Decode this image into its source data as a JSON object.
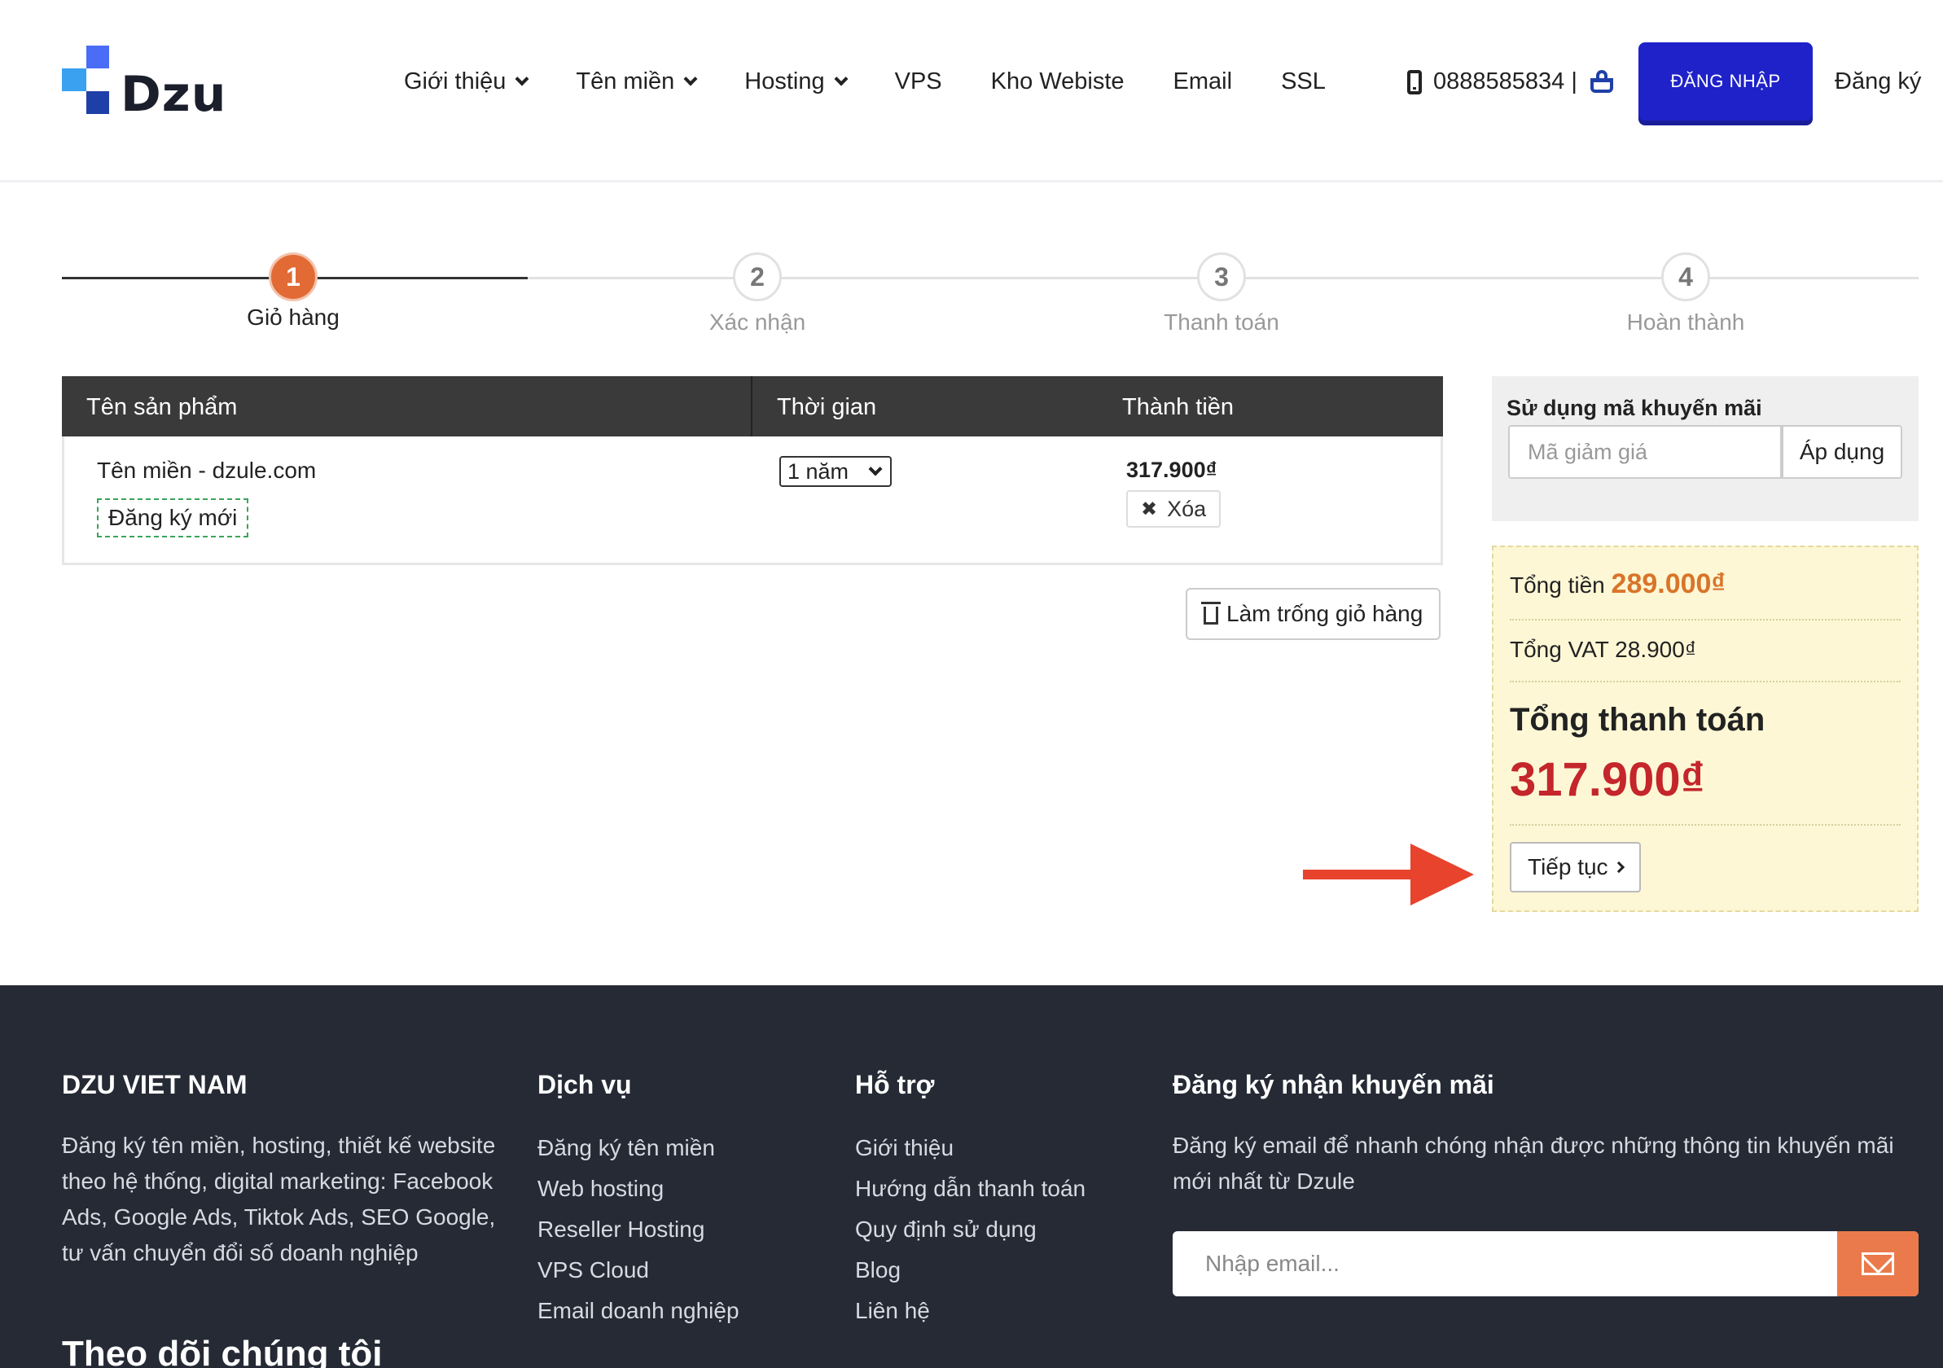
{
  "header": {
    "logo_text": "Dzu",
    "nav": [
      {
        "label": "Giới thiệu",
        "dropdown": true
      },
      {
        "label": "Tên miền",
        "dropdown": true
      },
      {
        "label": "Hosting",
        "dropdown": true
      },
      {
        "label": "VPS",
        "dropdown": false
      },
      {
        "label": "Kho Webiste",
        "dropdown": false
      },
      {
        "label": "Email",
        "dropdown": false
      },
      {
        "label": "SSL",
        "dropdown": false
      }
    ],
    "phone": "0888585834 |",
    "login_label": "ĐĂNG NHẬP",
    "register_label": "Đăng ký"
  },
  "steps": [
    {
      "number": "1",
      "label": "Giỏ hàng",
      "active": true
    },
    {
      "number": "2",
      "label": "Xác nhận",
      "active": false
    },
    {
      "number": "3",
      "label": "Thanh toán",
      "active": false
    },
    {
      "number": "4",
      "label": "Hoàn thành",
      "active": false
    }
  ],
  "cart": {
    "headers": [
      "Tên sản phẩm",
      "Thời gian",
      "Thành tiền"
    ],
    "items": [
      {
        "name": "Tên miền - dzule.com",
        "tag": "Đăng ký mới",
        "period": "1 năm",
        "price": "317.900₫",
        "remove_label": "Xóa"
      }
    ],
    "empty_label": "Làm trống giỏ hàng"
  },
  "promo": {
    "title": "Sử dụng mã khuyến mãi",
    "placeholder": "Mã giảm giá",
    "apply_label": "Áp dụng"
  },
  "summary": {
    "subtotal_label": "Tổng tiền",
    "subtotal_value": "289.000₫",
    "vat_label": "Tổng VAT 28.900₫",
    "total_label": "Tổng thanh toán",
    "total_value": "317.900₫",
    "continue_label": "Tiếp tục"
  },
  "footer": {
    "about_title": "DZU VIET NAM",
    "about_text": "Đăng ký tên miền, hosting, thiết kế website theo hệ thống, digital marketing: Facebook Ads, Google Ads, Tiktok Ads, SEO Google, tư vấn chuyển đổi số doanh nghiệp",
    "follow_title": "Theo dõi chúng tôi",
    "services_title": "Dịch vụ",
    "services": [
      "Đăng ký tên miền",
      "Web hosting",
      "Reseller Hosting",
      "VPS Cloud",
      "Email doanh nghiệp"
    ],
    "support_title": "Hỗ trợ",
    "support": [
      "Giới thiệu",
      "Hướng dẫn thanh toán",
      "Quy định sử dụng",
      "Blog",
      "Liên hệ"
    ],
    "newsletter_title": "Đăng ký nhận khuyến mãi",
    "newsletter_text": "Đăng ký email để nhanh chóng nhận được những thông tin khuyến mãi mới nhất từ Dzule",
    "email_placeholder": "Nhập email..."
  },
  "colors": {
    "login_button": "#1f22c8",
    "active_step": "#e26a35",
    "total_price": "#c4262b",
    "subtotal_price": "#d9742a",
    "footer_bg": "#252a35",
    "send_button": "#ea7a4b"
  }
}
